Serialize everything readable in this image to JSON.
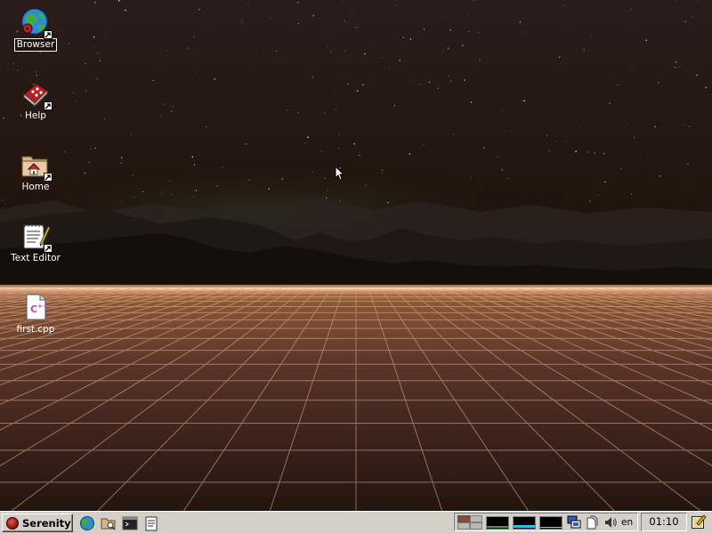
{
  "desktop": {
    "icons": [
      {
        "label": "Browser",
        "icon": "globe-icon"
      },
      {
        "label": "Help",
        "icon": "help-book-icon"
      },
      {
        "label": "Home",
        "icon": "home-folder-icon"
      },
      {
        "label": "Text Editor",
        "icon": "text-editor-icon"
      },
      {
        "label": "first.cpp",
        "icon": "cpp-file-icon"
      }
    ],
    "selected_icon": "Browser"
  },
  "taskbar": {
    "start_label": "Serenity",
    "quick_launch": [
      "browser-icon",
      "file-manager-icon",
      "terminal-icon",
      "text-editor-icon"
    ],
    "tray": {
      "keymap": "en",
      "clock": "01:10",
      "widgets": [
        "workspace-switcher",
        "cpu-graph",
        "memory-graph",
        "network-graph",
        "network-icon",
        "clipboard-icon",
        "volume-icon"
      ]
    }
  },
  "colors": {
    "taskbar_bg": "#d4d0c8",
    "grid_line": "#c89a72",
    "horizon_glow": "#ffd8a8"
  }
}
